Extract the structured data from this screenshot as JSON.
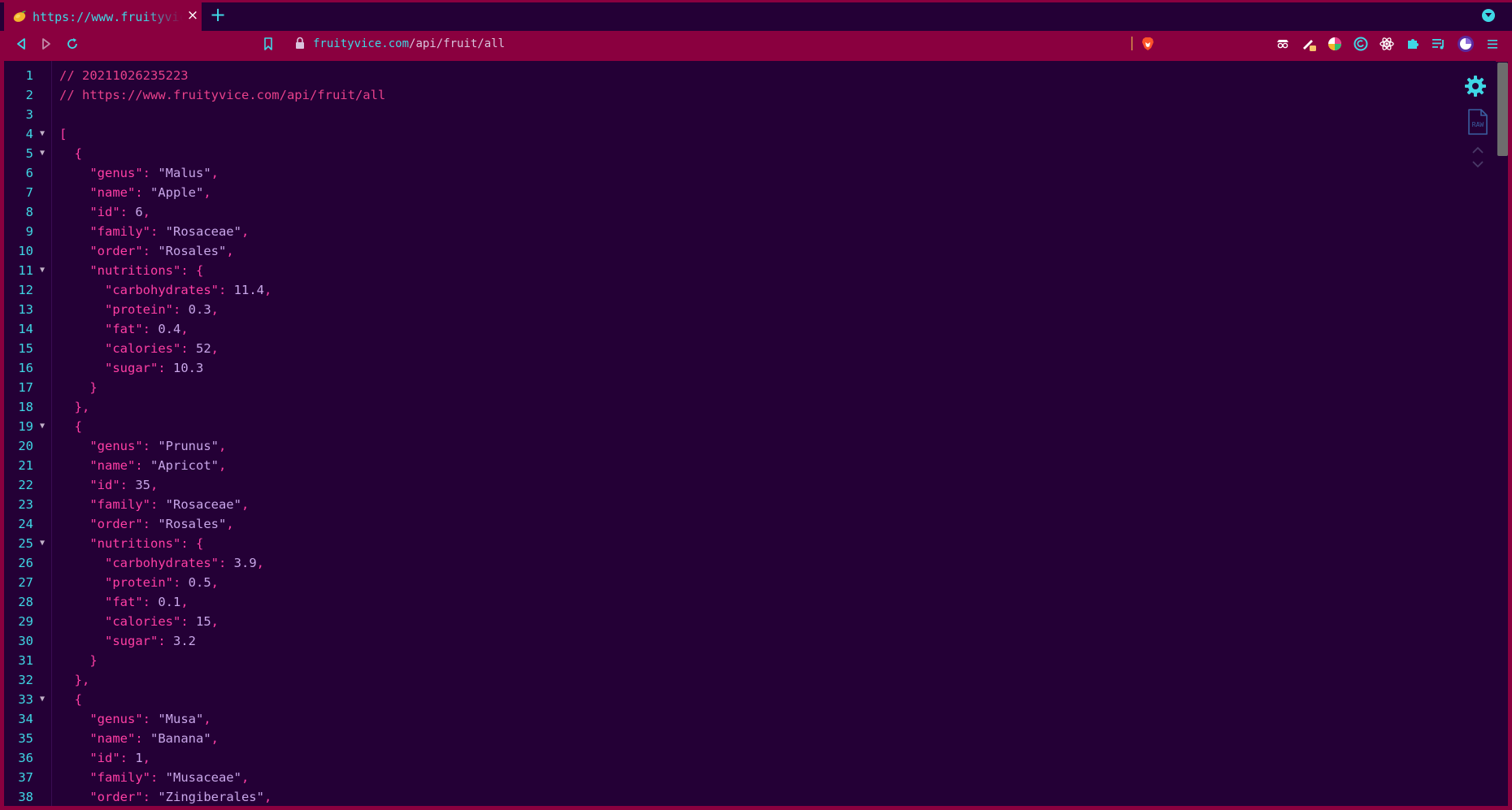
{
  "tab": {
    "title": "https://www.fruityvice.com/api/fruit/all",
    "close_glyph": "×",
    "favicon": "mango-icon"
  },
  "new_tab_glyph": "+",
  "toolbar": {
    "url_host": "fruityvice.com",
    "url_path": "/api/fruit/all",
    "extensions": [
      "spy-icon",
      "pen-icon",
      "color-wheel-icon",
      "grammarly-icon",
      "react-icon",
      "puzzle-icon",
      "playlist-icon",
      "profile-avatar",
      "menu-icon"
    ]
  },
  "colors": {
    "chrome": "#8a003f",
    "background": "#240036",
    "line_number": "#3fd7e5",
    "key": "#ff3fa4",
    "value": "#c8a6e8",
    "comment": "#e8418a"
  },
  "code_lines": [
    {
      "n": "1",
      "fold": "",
      "segs": [
        {
          "t": "// 20211026235223",
          "c": "c"
        }
      ]
    },
    {
      "n": "2",
      "fold": "",
      "segs": [
        {
          "t": "// https://www.fruityvice.com/api/fruit/all",
          "c": "c"
        }
      ]
    },
    {
      "n": "3",
      "fold": "",
      "segs": []
    },
    {
      "n": "4",
      "fold": "▼",
      "segs": [
        {
          "t": "[",
          "c": "p"
        }
      ]
    },
    {
      "n": "5",
      "fold": "▼",
      "segs": [
        {
          "t": "  {",
          "c": "p"
        }
      ]
    },
    {
      "n": "6",
      "fold": "",
      "segs": [
        {
          "t": "    ",
          "c": "p"
        },
        {
          "t": "\"genus\"",
          "c": "k"
        },
        {
          "t": ": ",
          "c": "p"
        },
        {
          "t": "\"Malus\"",
          "c": "s"
        },
        {
          "t": ",",
          "c": "p"
        }
      ]
    },
    {
      "n": "7",
      "fold": "",
      "segs": [
        {
          "t": "    ",
          "c": "p"
        },
        {
          "t": "\"name\"",
          "c": "k"
        },
        {
          "t": ": ",
          "c": "p"
        },
        {
          "t": "\"Apple\"",
          "c": "s"
        },
        {
          "t": ",",
          "c": "p"
        }
      ]
    },
    {
      "n": "8",
      "fold": "",
      "segs": [
        {
          "t": "    ",
          "c": "p"
        },
        {
          "t": "\"id\"",
          "c": "k"
        },
        {
          "t": ": ",
          "c": "p"
        },
        {
          "t": "6",
          "c": "n"
        },
        {
          "t": ",",
          "c": "p"
        }
      ]
    },
    {
      "n": "9",
      "fold": "",
      "segs": [
        {
          "t": "    ",
          "c": "p"
        },
        {
          "t": "\"family\"",
          "c": "k"
        },
        {
          "t": ": ",
          "c": "p"
        },
        {
          "t": "\"Rosaceae\"",
          "c": "s"
        },
        {
          "t": ",",
          "c": "p"
        }
      ]
    },
    {
      "n": "10",
      "fold": "",
      "segs": [
        {
          "t": "    ",
          "c": "p"
        },
        {
          "t": "\"order\"",
          "c": "k"
        },
        {
          "t": ": ",
          "c": "p"
        },
        {
          "t": "\"Rosales\"",
          "c": "s"
        },
        {
          "t": ",",
          "c": "p"
        }
      ]
    },
    {
      "n": "11",
      "fold": "▼",
      "segs": [
        {
          "t": "    ",
          "c": "p"
        },
        {
          "t": "\"nutritions\"",
          "c": "k"
        },
        {
          "t": ": {",
          "c": "p"
        }
      ]
    },
    {
      "n": "12",
      "fold": "",
      "segs": [
        {
          "t": "      ",
          "c": "p"
        },
        {
          "t": "\"carbohydrates\"",
          "c": "k"
        },
        {
          "t": ": ",
          "c": "p"
        },
        {
          "t": "11.4",
          "c": "n"
        },
        {
          "t": ",",
          "c": "p"
        }
      ]
    },
    {
      "n": "13",
      "fold": "",
      "segs": [
        {
          "t": "      ",
          "c": "p"
        },
        {
          "t": "\"protein\"",
          "c": "k"
        },
        {
          "t": ": ",
          "c": "p"
        },
        {
          "t": "0.3",
          "c": "n"
        },
        {
          "t": ",",
          "c": "p"
        }
      ]
    },
    {
      "n": "14",
      "fold": "",
      "segs": [
        {
          "t": "      ",
          "c": "p"
        },
        {
          "t": "\"fat\"",
          "c": "k"
        },
        {
          "t": ": ",
          "c": "p"
        },
        {
          "t": "0.4",
          "c": "n"
        },
        {
          "t": ",",
          "c": "p"
        }
      ]
    },
    {
      "n": "15",
      "fold": "",
      "segs": [
        {
          "t": "      ",
          "c": "p"
        },
        {
          "t": "\"calories\"",
          "c": "k"
        },
        {
          "t": ": ",
          "c": "p"
        },
        {
          "t": "52",
          "c": "n"
        },
        {
          "t": ",",
          "c": "p"
        }
      ]
    },
    {
      "n": "16",
      "fold": "",
      "segs": [
        {
          "t": "      ",
          "c": "p"
        },
        {
          "t": "\"sugar\"",
          "c": "k"
        },
        {
          "t": ": ",
          "c": "p"
        },
        {
          "t": "10.3",
          "c": "n"
        }
      ]
    },
    {
      "n": "17",
      "fold": "",
      "segs": [
        {
          "t": "    }",
          "c": "p"
        }
      ]
    },
    {
      "n": "18",
      "fold": "",
      "segs": [
        {
          "t": "  },",
          "c": "p"
        }
      ]
    },
    {
      "n": "19",
      "fold": "▼",
      "segs": [
        {
          "t": "  {",
          "c": "p"
        }
      ]
    },
    {
      "n": "20",
      "fold": "",
      "segs": [
        {
          "t": "    ",
          "c": "p"
        },
        {
          "t": "\"genus\"",
          "c": "k"
        },
        {
          "t": ": ",
          "c": "p"
        },
        {
          "t": "\"Prunus\"",
          "c": "s"
        },
        {
          "t": ",",
          "c": "p"
        }
      ]
    },
    {
      "n": "21",
      "fold": "",
      "segs": [
        {
          "t": "    ",
          "c": "p"
        },
        {
          "t": "\"name\"",
          "c": "k"
        },
        {
          "t": ": ",
          "c": "p"
        },
        {
          "t": "\"Apricot\"",
          "c": "s"
        },
        {
          "t": ",",
          "c": "p"
        }
      ]
    },
    {
      "n": "22",
      "fold": "",
      "segs": [
        {
          "t": "    ",
          "c": "p"
        },
        {
          "t": "\"id\"",
          "c": "k"
        },
        {
          "t": ": ",
          "c": "p"
        },
        {
          "t": "35",
          "c": "n"
        },
        {
          "t": ",",
          "c": "p"
        }
      ]
    },
    {
      "n": "23",
      "fold": "",
      "segs": [
        {
          "t": "    ",
          "c": "p"
        },
        {
          "t": "\"family\"",
          "c": "k"
        },
        {
          "t": ": ",
          "c": "p"
        },
        {
          "t": "\"Rosaceae\"",
          "c": "s"
        },
        {
          "t": ",",
          "c": "p"
        }
      ]
    },
    {
      "n": "24",
      "fold": "",
      "segs": [
        {
          "t": "    ",
          "c": "p"
        },
        {
          "t": "\"order\"",
          "c": "k"
        },
        {
          "t": ": ",
          "c": "p"
        },
        {
          "t": "\"Rosales\"",
          "c": "s"
        },
        {
          "t": ",",
          "c": "p"
        }
      ]
    },
    {
      "n": "25",
      "fold": "▼",
      "segs": [
        {
          "t": "    ",
          "c": "p"
        },
        {
          "t": "\"nutritions\"",
          "c": "k"
        },
        {
          "t": ": {",
          "c": "p"
        }
      ]
    },
    {
      "n": "26",
      "fold": "",
      "segs": [
        {
          "t": "      ",
          "c": "p"
        },
        {
          "t": "\"carbohydrates\"",
          "c": "k"
        },
        {
          "t": ": ",
          "c": "p"
        },
        {
          "t": "3.9",
          "c": "n"
        },
        {
          "t": ",",
          "c": "p"
        }
      ]
    },
    {
      "n": "27",
      "fold": "",
      "segs": [
        {
          "t": "      ",
          "c": "p"
        },
        {
          "t": "\"protein\"",
          "c": "k"
        },
        {
          "t": ": ",
          "c": "p"
        },
        {
          "t": "0.5",
          "c": "n"
        },
        {
          "t": ",",
          "c": "p"
        }
      ]
    },
    {
      "n": "28",
      "fold": "",
      "segs": [
        {
          "t": "      ",
          "c": "p"
        },
        {
          "t": "\"fat\"",
          "c": "k"
        },
        {
          "t": ": ",
          "c": "p"
        },
        {
          "t": "0.1",
          "c": "n"
        },
        {
          "t": ",",
          "c": "p"
        }
      ]
    },
    {
      "n": "29",
      "fold": "",
      "segs": [
        {
          "t": "      ",
          "c": "p"
        },
        {
          "t": "\"calories\"",
          "c": "k"
        },
        {
          "t": ": ",
          "c": "p"
        },
        {
          "t": "15",
          "c": "n"
        },
        {
          "t": ",",
          "c": "p"
        }
      ]
    },
    {
      "n": "30",
      "fold": "",
      "segs": [
        {
          "t": "      ",
          "c": "p"
        },
        {
          "t": "\"sugar\"",
          "c": "k"
        },
        {
          "t": ": ",
          "c": "p"
        },
        {
          "t": "3.2",
          "c": "n"
        }
      ]
    },
    {
      "n": "31",
      "fold": "",
      "segs": [
        {
          "t": "    }",
          "c": "p"
        }
      ]
    },
    {
      "n": "32",
      "fold": "",
      "segs": [
        {
          "t": "  },",
          "c": "p"
        }
      ]
    },
    {
      "n": "33",
      "fold": "▼",
      "segs": [
        {
          "t": "  {",
          "c": "p"
        }
      ]
    },
    {
      "n": "34",
      "fold": "",
      "segs": [
        {
          "t": "    ",
          "c": "p"
        },
        {
          "t": "\"genus\"",
          "c": "k"
        },
        {
          "t": ": ",
          "c": "p"
        },
        {
          "t": "\"Musa\"",
          "c": "s"
        },
        {
          "t": ",",
          "c": "p"
        }
      ]
    },
    {
      "n": "35",
      "fold": "",
      "segs": [
        {
          "t": "    ",
          "c": "p"
        },
        {
          "t": "\"name\"",
          "c": "k"
        },
        {
          "t": ": ",
          "c": "p"
        },
        {
          "t": "\"Banana\"",
          "c": "s"
        },
        {
          "t": ",",
          "c": "p"
        }
      ]
    },
    {
      "n": "36",
      "fold": "",
      "segs": [
        {
          "t": "    ",
          "c": "p"
        },
        {
          "t": "\"id\"",
          "c": "k"
        },
        {
          "t": ": ",
          "c": "p"
        },
        {
          "t": "1",
          "c": "n"
        },
        {
          "t": ",",
          "c": "p"
        }
      ]
    },
    {
      "n": "37",
      "fold": "",
      "segs": [
        {
          "t": "    ",
          "c": "p"
        },
        {
          "t": "\"family\"",
          "c": "k"
        },
        {
          "t": ": ",
          "c": "p"
        },
        {
          "t": "\"Musaceae\"",
          "c": "s"
        },
        {
          "t": ",",
          "c": "p"
        }
      ]
    },
    {
      "n": "38",
      "fold": "",
      "segs": [
        {
          "t": "    ",
          "c": "p"
        },
        {
          "t": "\"order\"",
          "c": "k"
        },
        {
          "t": ": ",
          "c": "p"
        },
        {
          "t": "\"Zingiberales\"",
          "c": "s"
        },
        {
          "t": ",",
          "c": "p"
        }
      ]
    }
  ],
  "viewer_controls": [
    "settings-gear-icon",
    "raw-view-icon",
    "collapse-up-icon",
    "expand-down-icon"
  ]
}
